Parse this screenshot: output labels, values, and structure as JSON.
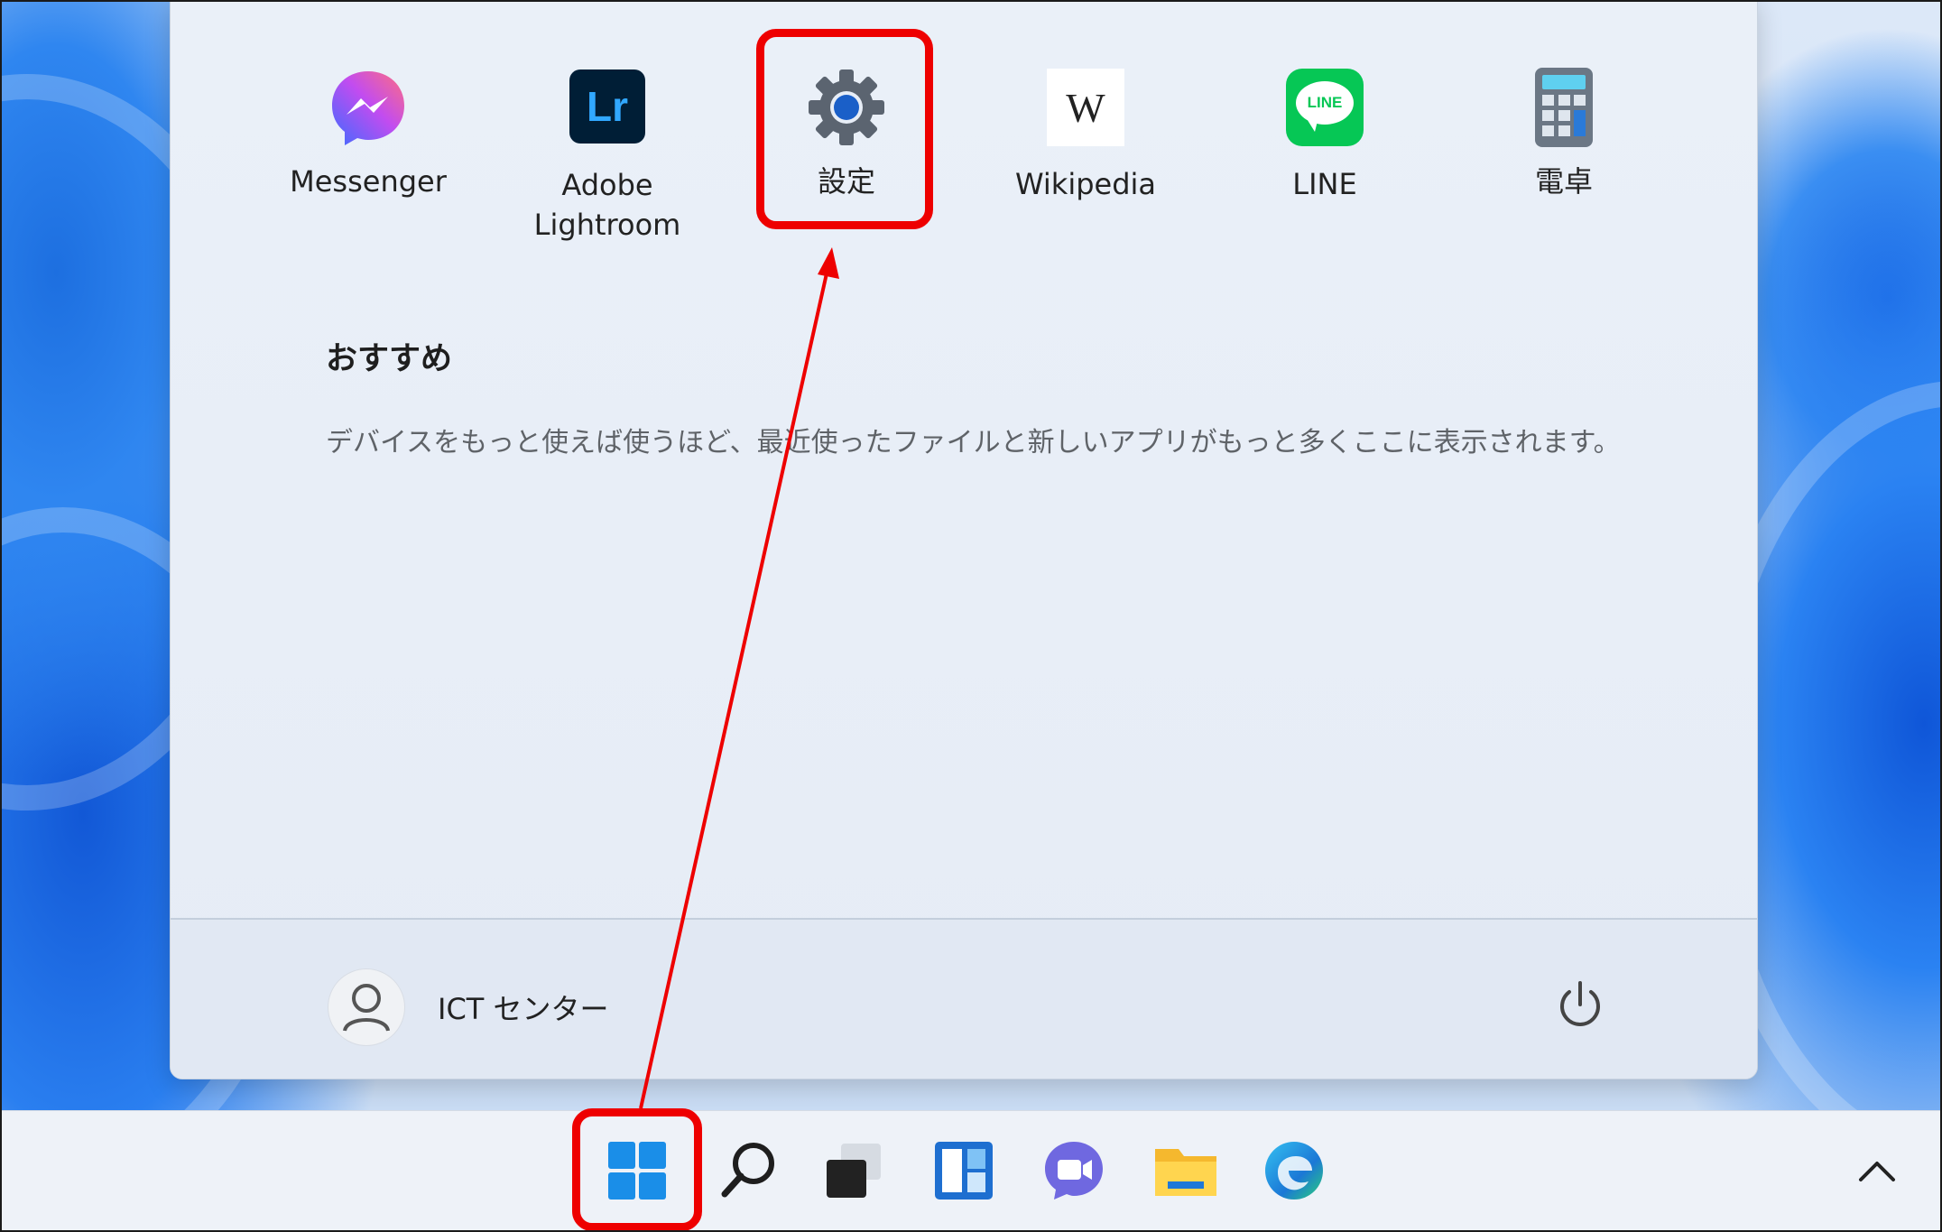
{
  "start_menu": {
    "pinned_apps": [
      {
        "label": "Messenger",
        "icon": "messenger-icon"
      },
      {
        "label": "Adobe\nLightroom",
        "icon": "lightroom-icon"
      },
      {
        "label": "設定",
        "icon": "settings-gear-icon"
      },
      {
        "label": "Wikipedia",
        "icon": "wikipedia-icon"
      },
      {
        "label": "LINE",
        "icon": "line-icon"
      },
      {
        "label": "電卓",
        "icon": "calculator-icon"
      }
    ],
    "lightroom_tile_text": "Lr",
    "wikipedia_tile_text": "W",
    "line_tile_text": "LINE",
    "recommended": {
      "title": "おすすめ",
      "message": "デバイスをもっと使えば使うほど、最近使ったファイルと新しいアプリがもっと多くここに表示されます。"
    },
    "user": {
      "name": "ICT センター",
      "icon": "user-avatar-icon"
    },
    "power_icon": "power-icon"
  },
  "taskbar": {
    "icons": [
      "start-windows-icon",
      "search-icon",
      "task-view-icon",
      "widgets-icon",
      "chat-icon",
      "file-explorer-icon",
      "edge-icon"
    ],
    "tray_icon": "chevron-up-icon"
  },
  "colors": {
    "annotation_red": "#ee0000",
    "messenger_gradient": [
      "#3b6cff",
      "#c24cf0",
      "#ff5c8a"
    ],
    "lightroom_bg": "#001e36",
    "lightroom_text": "#31a8ff",
    "line_green": "#06c755",
    "windows_blue": "#1a8ee8"
  }
}
